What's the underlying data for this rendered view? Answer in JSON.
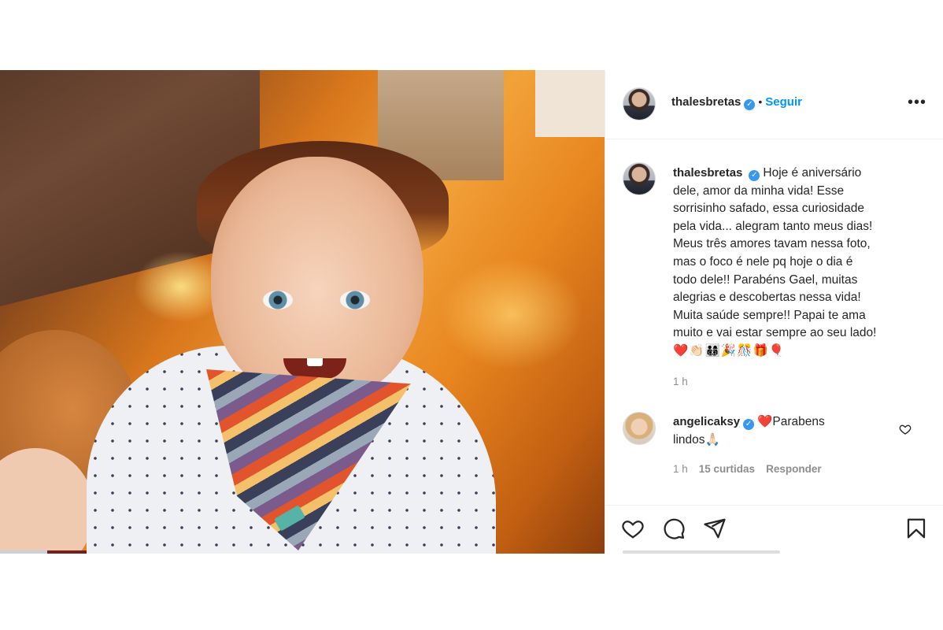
{
  "post": {
    "author": {
      "username": "thalesbretas",
      "follow_label": "Seguir",
      "separator": "•",
      "verified_icon": "verified-badge-icon"
    },
    "menu_icon": "more-options-icon",
    "caption": {
      "username": "thalesbretas",
      "lines": [
        "Hoje é aniversário",
        "dele, amor da minha vida! Esse",
        "sorrisinho safado, essa curiosidade",
        "pela vida... alegram tanto meus dias!",
        "Meus três amores tavam nessa foto,",
        "mas o foco é nele pq hoje o dia é",
        "todo dele!! Parabéns Gael, muitas",
        "alegrias e descobertas nessa vida!",
        "Muita saúde sempre!! Papai te ama",
        "muito e vai estar sempre ao seu lado!"
      ],
      "emojis": "❤️👏🏻👨‍👩‍👦‍👦🎉🎊🎁🎈",
      "time": "1 h"
    },
    "comment": {
      "username": "angelicaksy",
      "text_line1": "Parabens",
      "text_line2": "lindos🙏🏻",
      "heart_emoji": "❤️",
      "time": "1 h",
      "likes": "15 curtidas",
      "reply_label": "Responder"
    },
    "actions": {
      "like_icon": "heart-icon",
      "comment_icon": "comment-icon",
      "share_icon": "share-icon",
      "save_icon": "bookmark-icon"
    },
    "colors": {
      "link_blue": "#0095f6",
      "verified_blue": "#3897f0",
      "muted": "#8e8e8e",
      "heart_red": "#ed1c24"
    }
  }
}
